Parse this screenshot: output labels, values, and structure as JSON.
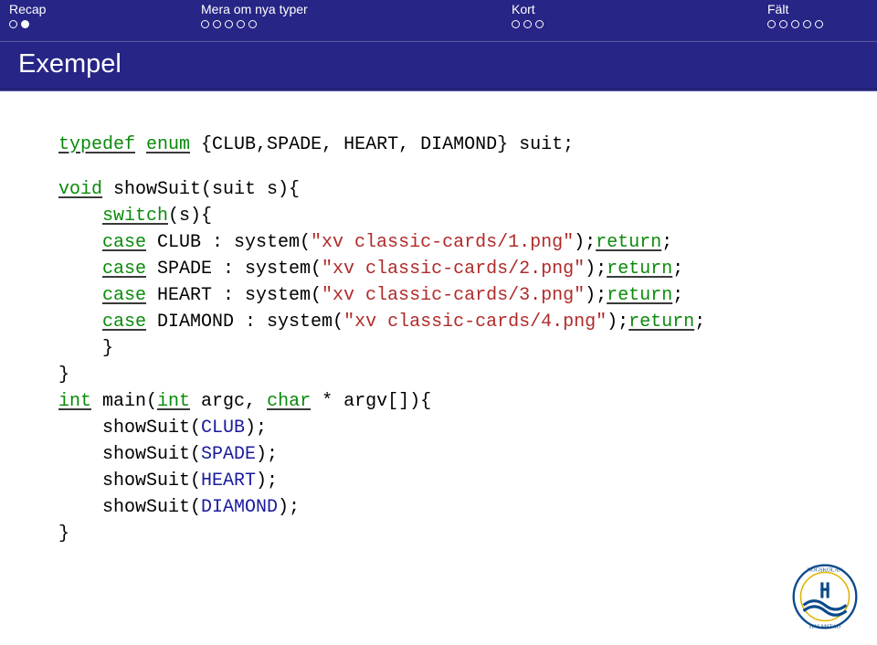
{
  "nav": {
    "sections": [
      {
        "label": "Recap",
        "total": 2,
        "current": 1
      },
      {
        "label": "Mera om nya typer",
        "total": 5,
        "current": -1
      },
      {
        "label": "Kort",
        "total": 3,
        "current": -1
      },
      {
        "label": "Fält",
        "total": 5,
        "current": -1
      }
    ]
  },
  "title": "Exempel",
  "code": {
    "l1": {
      "kw1": "typedef",
      "kw2": "enum",
      "body": " {CLUB,SPADE, HEART, DIAMOND} suit;"
    },
    "l2": {
      "kw": "void",
      "rest": " showSuit(suit s){"
    },
    "l3": {
      "kw": "switch",
      "rest": "(s){"
    },
    "l4": {
      "kw": "case",
      "id": " CLUB : system(",
      "str": "\"xv classic-cards/1.png\"",
      "tail": ");",
      "ret": "return",
      "semi": ";"
    },
    "l5": {
      "kw": "case",
      "id": " SPADE : system(",
      "str": "\"xv classic-cards/2.png\"",
      "tail": ");",
      "ret": "return",
      "semi": ";"
    },
    "l6": {
      "kw": "case",
      "id": " HEART : system(",
      "str": "\"xv classic-cards/3.png\"",
      "tail": ");",
      "ret": "return",
      "semi": ";"
    },
    "l7": {
      "kw": "case",
      "id": " DIAMOND : system(",
      "str": "\"xv classic-cards/4.png\"",
      "tail": ");",
      "ret": "return",
      "semi": ";"
    },
    "l8": "}",
    "l9": "}",
    "m1": {
      "kw": "int",
      "name": " main(",
      "kw2": "int",
      "mid": " argc, ",
      "kw3": "char",
      "rest": " * argv[]){"
    },
    "m2": {
      "fn": "showSuit(",
      "arg": "CLUB",
      "tail": ");"
    },
    "m3": {
      "fn": "showSuit(",
      "arg": "SPADE",
      "tail": ");"
    },
    "m4": {
      "fn": "showSuit(",
      "arg": "HEART",
      "tail": ");"
    },
    "m5": {
      "fn": "showSuit(",
      "arg": "DIAMOND",
      "tail": ");"
    },
    "m6": "}"
  },
  "logo_alt": "Högskolan i Halmstad"
}
